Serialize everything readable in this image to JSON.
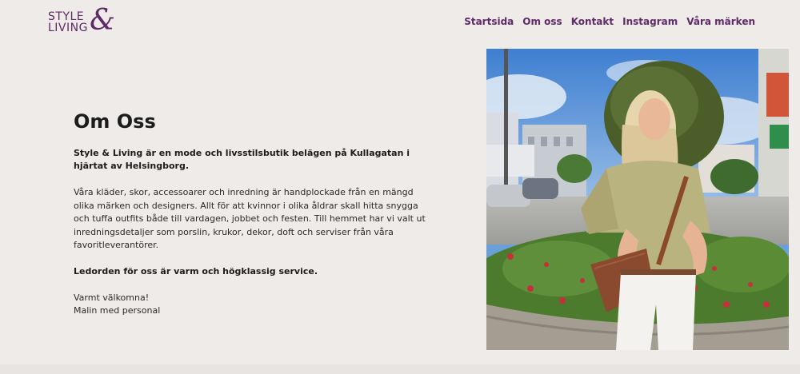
{
  "brand": {
    "line1": "STYLE",
    "line2": "LIVING",
    "amp": "&"
  },
  "nav": [
    {
      "label": "Startsida"
    },
    {
      "label": "Om oss"
    },
    {
      "label": "Kontakt"
    },
    {
      "label": "Instagram"
    },
    {
      "label": "Våra märken"
    }
  ],
  "about": {
    "title": "Om Oss",
    "lead": "Style & Living är en mode och livsstilsbutik belägen på Kullagatan i hjärtat av Helsingborg.",
    "body": "Våra kläder, skor, accessoarer och inredning är handplockade från en mängd olika märken och designers. Allt för att kvinnor i olika åldrar skall hitta snygga och tuffa outfits både till vardagen, jobbet och festen. Till hemmet har vi valt ut inredningsdetaljer som porslin, krukor, dekor, doft och serviser från våra favoritleverantörer.",
    "motto": "Ledorden för oss är varm och högklassig service.",
    "greeting": "Varmt välkomna!",
    "signature": "Malin med personal"
  },
  "colors": {
    "brand": "#5e2a68",
    "background": "#efebe8"
  }
}
